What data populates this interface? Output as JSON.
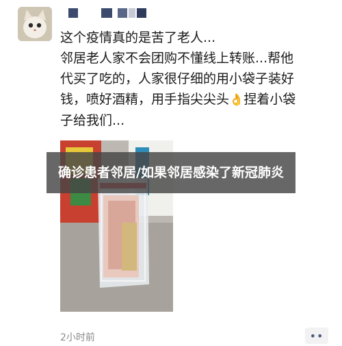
{
  "post": {
    "lines": [
      "这个疫情真的是苦了老人...",
      "邻居老人家不会团购不懂线上转账...帮他",
      "代买了吃的，人家很仔细的用小袋子装好",
      "钱，喷好酒精，用手指尖尖头",
      "捏着小袋",
      "子给我们..."
    ],
    "emoji_icon": "pinching-hand-icon",
    "emoji_glyph": "👌",
    "timestamp": "2小时前",
    "more_label": "••"
  },
  "overlay": {
    "title": "确诊患者邻居/如果邻居感染了新冠肺炎"
  },
  "colors": {
    "name_blur": "#3c4a6e",
    "more_dots": "#4a5a80",
    "timestamp": "#8a8a8a",
    "overlay_bg": "#464646"
  }
}
